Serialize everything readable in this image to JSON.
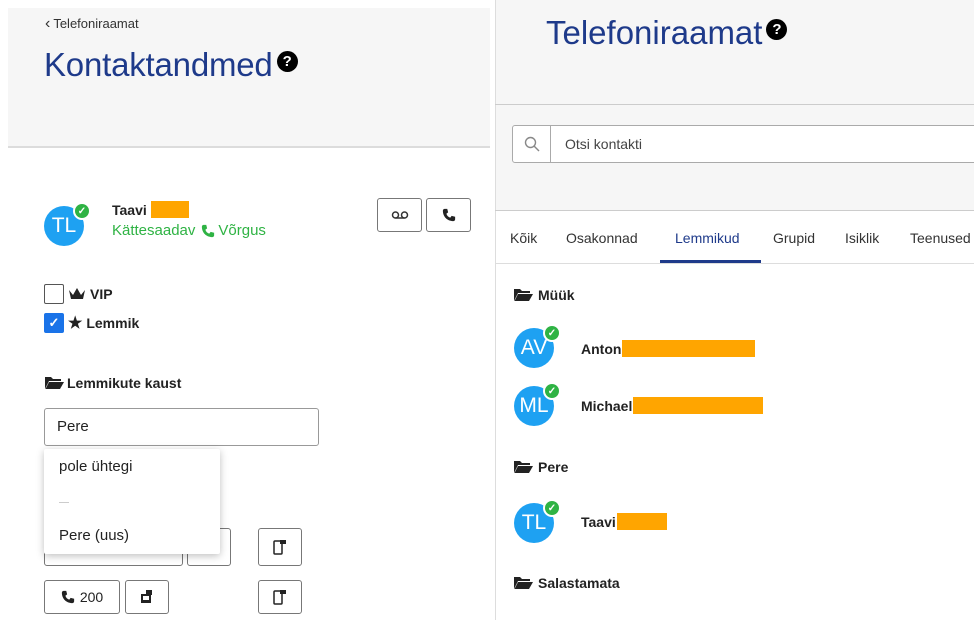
{
  "left": {
    "back_label": "Telefoniraamat",
    "title": "Kontaktandmed",
    "help_glyph": "?",
    "contact": {
      "initials": "TL",
      "name": "Taavi",
      "status_text": "Kättesaadav",
      "network_text": "Võrgus"
    },
    "vip_label": "VIP",
    "vip_checked": false,
    "fav_label": "Lemmik",
    "fav_checked": true,
    "folder_section_label": "Lemmikute kaust",
    "folder_value": "Pere",
    "dropdown_options": [
      "pole ühtegi",
      "Pere (uus)"
    ],
    "ext_number": "200",
    "icons": {
      "voicemail": "voicemail-icon",
      "call": "phone-icon",
      "crown": "crown-icon",
      "star": "star-icon",
      "folder": "folder-open-icon",
      "mobile": "mobile-phone-icon",
      "transfer": "transfer-icon"
    }
  },
  "right": {
    "title": "Telefoniraamat",
    "help_glyph": "?",
    "search_placeholder": "Otsi kontakti",
    "tabs": [
      {
        "label": "Kõik"
      },
      {
        "label": "Osakonnad"
      },
      {
        "label": "Lemmikud",
        "active": true
      },
      {
        "label": "Grupid"
      },
      {
        "label": "Isiklik"
      },
      {
        "label": "Teenused"
      }
    ],
    "groups": [
      {
        "name": "Müük",
        "contacts": [
          {
            "initials": "AV",
            "name": "Anton"
          },
          {
            "initials": "ML",
            "name": "Michael"
          }
        ]
      },
      {
        "name": "Pere",
        "contacts": [
          {
            "initials": "TL",
            "name": "Taavi"
          }
        ]
      },
      {
        "name": "Salastamata",
        "contacts": []
      }
    ]
  },
  "colors": {
    "title_blue": "#1e3a8a",
    "avatar_blue": "#1ea1f2",
    "online_green": "#2fb344",
    "redaction": "#ffa500",
    "checkbox_blue": "#1a73e8"
  }
}
